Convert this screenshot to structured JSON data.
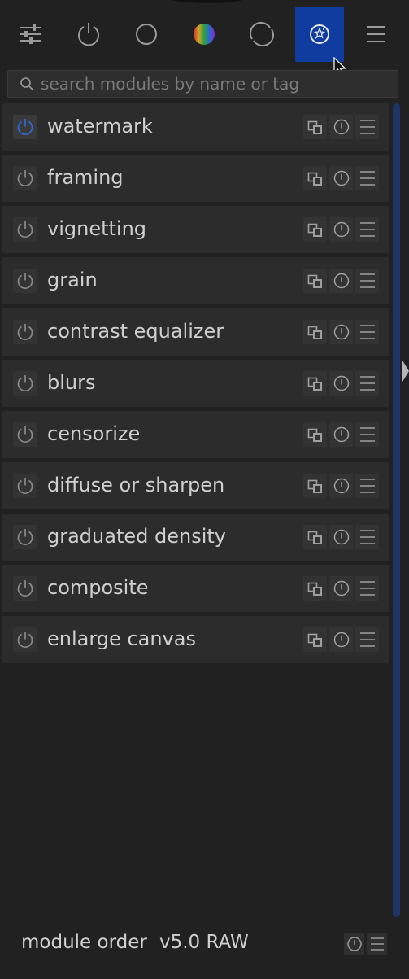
{
  "tabs": [
    {
      "icon": "sliders-icon",
      "label": "quick access panel"
    },
    {
      "icon": "power-icon",
      "label": "active modules"
    },
    {
      "icon": "circle-icon",
      "label": "base"
    },
    {
      "icon": "color-circle-icon",
      "label": "color"
    },
    {
      "icon": "correct-icon",
      "label": "correct"
    },
    {
      "icon": "effect-icon",
      "label": "effect",
      "active": true
    },
    {
      "icon": "hamburger-icon",
      "label": "presets"
    }
  ],
  "search": {
    "placeholder": "search modules by name or tag",
    "value": ""
  },
  "modules": [
    {
      "name": "watermark",
      "enabled": true
    },
    {
      "name": "framing",
      "enabled": false
    },
    {
      "name": "vignetting",
      "enabled": false
    },
    {
      "name": "grain",
      "enabled": false
    },
    {
      "name": "contrast equalizer",
      "enabled": false
    },
    {
      "name": "blurs",
      "enabled": false
    },
    {
      "name": "censorize",
      "enabled": false
    },
    {
      "name": "diffuse or sharpen",
      "enabled": false
    },
    {
      "name": "graduated density",
      "enabled": false
    },
    {
      "name": "composite",
      "enabled": false
    },
    {
      "name": "enlarge canvas",
      "enabled": false
    }
  ],
  "footer": {
    "label": "module order",
    "value": "v5.0 RAW"
  },
  "colors": {
    "accent": "#0f3c9e",
    "power_on": "#2f6bd6",
    "panel": "#2c2c2c",
    "background": "#212121"
  }
}
